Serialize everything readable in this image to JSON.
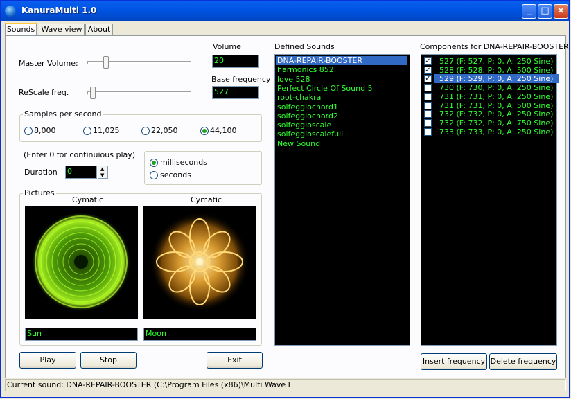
{
  "window": {
    "title": "KanuraMulti 1.0"
  },
  "tabs": [
    "Sounds",
    "Wave view",
    "About"
  ],
  "volume": {
    "master_label": "Master Volume:",
    "master_level": 0.18,
    "label": "Volume",
    "value": "20"
  },
  "rescale": {
    "label": "ReScale freq.",
    "level": 0.03,
    "base_label": "Base frequency",
    "base_value": "527"
  },
  "samples": {
    "label": "Samples per second",
    "options": [
      "8,000",
      "11,025",
      "22,050",
      "44,100"
    ],
    "selected": "44,100"
  },
  "duration": {
    "hint": "(Enter 0 for continuious play)",
    "label": "Duration",
    "value": "0",
    "units": [
      "milliseconds",
      "seconds"
    ],
    "selected_unit": "milliseconds"
  },
  "pictures": {
    "label": "Pictures",
    "left": {
      "caption": "Cymatic",
      "name": "Sun"
    },
    "right": {
      "caption": "Cymatic",
      "name": "Moon"
    }
  },
  "buttons": {
    "play": "Play",
    "stop": "Stop",
    "exit": "Exit",
    "insert": "Insert frequency",
    "delete": "Delete frequency"
  },
  "defined_sounds": {
    "label": "Defined Sounds",
    "items": [
      "DNA-REPAIR-BOOSTER",
      "harmonics 852",
      "love 528",
      "Perfect Circle Of Sound 5",
      "root-chakra",
      "solfeggiochord1",
      "solfeggiochord2",
      "solfeggioscale",
      "solfeggioscalefull",
      "New Sound"
    ],
    "selected_index": 0
  },
  "components": {
    "label": "Components for DNA-REPAIR-BOOSTER",
    "items": [
      {
        "text": "527 (F: 527, P:   0, A: 250  Sine)",
        "checked": true
      },
      {
        "text": "528 (F: 528, P:   0, A: 500  Sine)",
        "checked": true
      },
      {
        "text": "529 (F: 529, P:   0, A: 250  Sine)",
        "checked": true
      },
      {
        "text": "730 (F: 730, P:   0, A: 250  Sine)",
        "checked": false
      },
      {
        "text": "731 (F: 731, P:   0, A: 250  Sine)",
        "checked": false
      },
      {
        "text": "731 (F: 731, P:   0, A: 500  Sine)",
        "checked": false
      },
      {
        "text": "732 (F: 732, P:   0, A: 250  Sine)",
        "checked": false
      },
      {
        "text": "732 (F: 732, P:   0, A: 750  Sine)",
        "checked": false
      },
      {
        "text": "733 (F: 733, P:   0, A: 250  Sine)",
        "checked": false
      }
    ],
    "selected_index": 2
  },
  "status": {
    "text": "Current sound: DNA-REPAIR-BOOSTER (C:\\Program Files (x86)\\Multi Wave I"
  },
  "colors": {
    "list_text": "#30ff30",
    "selection": "#316ac5",
    "titlebar": "#0055e5"
  },
  "icons": {
    "app": "globe-icon",
    "minimize": "minimize-icon",
    "maximize": "maximize-icon",
    "close": "close-icon"
  }
}
